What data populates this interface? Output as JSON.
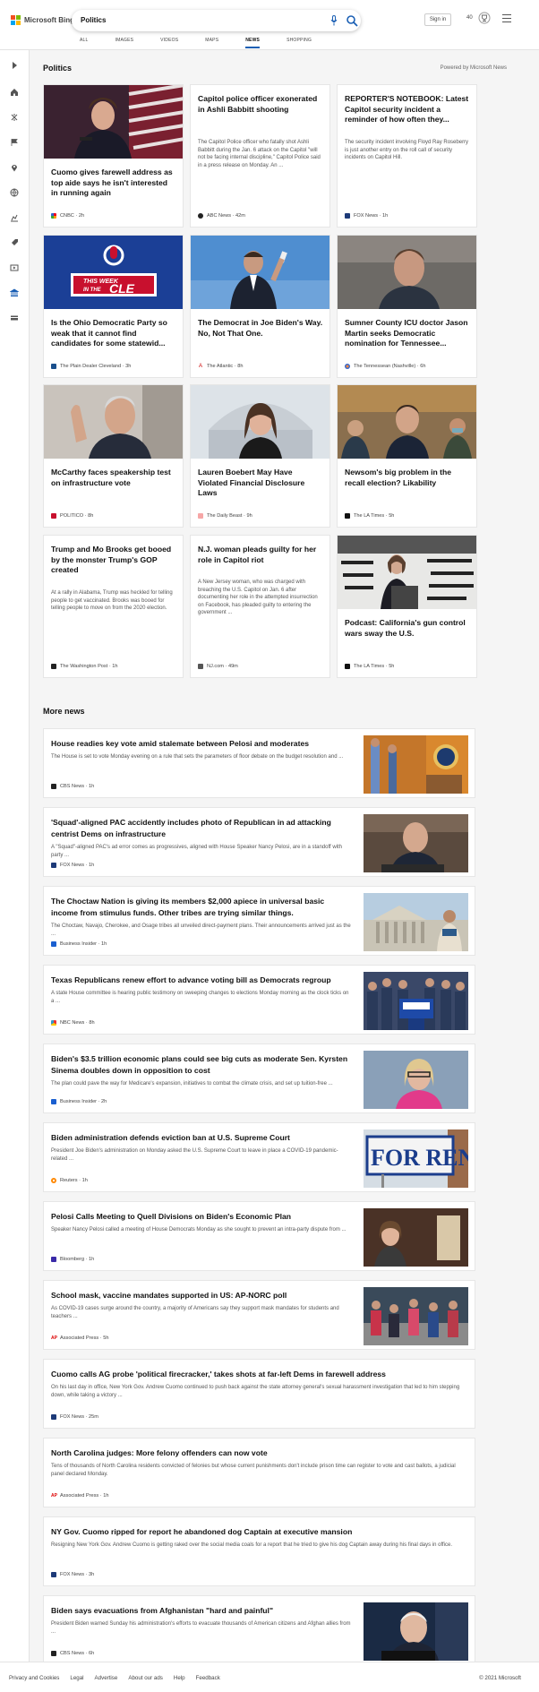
{
  "header": {
    "brand": "Microsoft Bing",
    "query": "Politics",
    "sign_in": "Sign in",
    "rewards": "40",
    "tabs": [
      {
        "label": "ALL"
      },
      {
        "label": "IMAGES"
      },
      {
        "label": "VIDEOS"
      },
      {
        "label": "MAPS"
      },
      {
        "label": "NEWS"
      },
      {
        "label": "SHOPPING"
      }
    ],
    "active_tab": "NEWS"
  },
  "colors": {
    "ms_red": "#f25022",
    "ms_green": "#7fba00",
    "ms_blue": "#00a4ef",
    "ms_yellow": "#ffb900",
    "accent": "#1a5fb4"
  },
  "section": {
    "title": "Politics",
    "powered": "Powered by Microsoft News"
  },
  "cards": [
    {
      "title": "Cuomo gives farewell address as top aide says he isn't interested in running again",
      "desc": "",
      "source": "CNBC",
      "age": "2h",
      "icon": "cnbc-icon",
      "img": "photo-cuomo"
    },
    {
      "title": "Capitol police officer exonerated in Ashli Babbitt shooting",
      "desc": "The Capitol Police officer who fatally shot Ashli Babbitt during the Jan. 6 attack on the Capitol \"will not be facing internal discipline,\" Capitol Police said in a press release on Monday. An ...",
      "source": "ABC News",
      "age": "42m",
      "icon": "abc-news-icon",
      "img": ""
    },
    {
      "title": "REPORTER'S NOTEBOOK: Latest Capitol security incident a reminder of how often they...",
      "desc": "The security incident involving Floyd Ray Roseberry is just another entry on the roll call of security incidents on Capitol Hill.",
      "source": "FOX News",
      "age": "1h",
      "icon": "fox-news-icon",
      "img": ""
    },
    {
      "title": "Is the Ohio Democratic Party so weak that it cannot find candidates for some statewid...",
      "desc": "",
      "source": "The Plain Dealer Cleveland",
      "age": "3h",
      "icon": "plain-dealer-icon",
      "img": "this-week-in-the-cle"
    },
    {
      "title": "The Democrat in Joe Biden's Way. No, Not That One.",
      "desc": "",
      "source": "The Atlantic",
      "age": "8h",
      "icon": "the-atlantic-icon",
      "img": "photo-politician-phone"
    },
    {
      "title": "Sumner County ICU doctor Jason Martin seeks Democratic nomination for Tennessee...",
      "desc": "",
      "source": "The Tennessean (Nashville)",
      "age": "6h",
      "icon": "tennessean-icon",
      "img": "photo-jason-martin"
    },
    {
      "title": "McCarthy faces speakership test on infrastructure vote",
      "desc": "",
      "source": "POLITICO",
      "age": "8h",
      "icon": "politico-icon",
      "img": "photo-mccarthy"
    },
    {
      "title": "Lauren Boebert May Have Violated Financial Disclosure Laws",
      "desc": "",
      "source": "The Daily Beast",
      "age": "9h",
      "icon": "daily-beast-icon",
      "img": "photo-boebert"
    },
    {
      "title": "Newsom's big problem in the recall election? Likability",
      "desc": "",
      "source": "The LA Times",
      "age": "5h",
      "icon": "la-times-icon",
      "img": "photo-newsom"
    },
    {
      "title": "Trump and Mo Brooks get booed by the monster Trump's GOP created",
      "desc": "At a rally in Alabama, Trump was heckled for telling people to get vaccinated. Brooks was booed for telling people to move on from the 2020 election.",
      "source": "The Washington Post",
      "age": "1h",
      "icon": "washington-post-icon",
      "img": ""
    },
    {
      "title": "N.J. woman pleads guilty for her role in Capitol riot",
      "desc": "A New Jersey woman, who was charged with breaching the U.S. Capitol on Jan. 6 after documenting her role in the attempted insurrection on Facebook, has pleaded guilty to entering the government ...",
      "source": "NJ.com",
      "age": "49m",
      "icon": "nj-com-icon",
      "img": ""
    },
    {
      "title": "Podcast: California's gun control wars sway the U.S.",
      "desc": "",
      "source": "The LA Times",
      "age": "5h",
      "icon": "la-times-icon",
      "img": "photo-gun-display"
    }
  ],
  "more_news": {
    "title": "More news",
    "items": [
      {
        "title": "House readies key vote amid stalemate between Pelosi and moderates",
        "desc": "The House is set to vote Monday evening on a rule that sets the parameters of floor debate on the budget resolution and ...",
        "source": "CBS News",
        "age": "1h",
        "icon": "cbs-news-icon",
        "img": "photo-house-podium"
      },
      {
        "title": "'Squad'-aligned PAC accidently includes photo of Republican in ad attacking centrist Dems on infrastructure",
        "desc": "A \"Squad\"-aligned PAC's ad error comes as progressives, aligned with House Speaker Nancy Pelosi, are in a standoff with party ...",
        "source": "FOX News",
        "age": "1h",
        "icon": "fox-news-icon",
        "img": "photo-senator"
      },
      {
        "title": "The Choctaw Nation is giving its members $2,000 apiece in universal basic income from stimulus funds. Other tribes are trying similar things.",
        "desc": "The Choctaw, Navajo, Cherokee, and Osage tribes all unveiled direct-payment plans. Their announcements arrived just as the ...",
        "source": "Business Insider",
        "age": "1h",
        "icon": "business-insider-icon",
        "img": "photo-capitol-building"
      },
      {
        "title": "Texas Republicans renew effort to advance voting bill as Democrats regroup",
        "desc": "A state House committee is hearing public testimony on sweeping changes to elections Monday morning as the clock ticks on a ...",
        "source": "NBC News",
        "age": "8h",
        "icon": "nbc-news-icon",
        "img": "photo-rally"
      },
      {
        "title": "Biden's $3.5 trillion economic plans could see big cuts as moderate Sen. Kyrsten Sinema doubles down in opposition to cost",
        "desc": "The plan could pave the way for Medicare's expansion, initiatives to combat the climate crisis, and set up tuition-free ...",
        "source": "Business Insider",
        "age": "2h",
        "icon": "business-insider-icon",
        "img": "photo-sinema"
      },
      {
        "title": "Biden administration defends eviction ban at U.S. Supreme Court",
        "desc": "President Joe Biden's administration on Monday asked the U.S. Supreme Court to leave in place a COVID-19 pandemic-related ...",
        "source": "Reuters",
        "age": "1h",
        "icon": "reuters-icon",
        "img": "for-rent-sign",
        "img_text": "FOR RENT"
      },
      {
        "title": "Pelosi Calls Meeting to Quell Divisions on Biden's Economic Plan",
        "desc": "Speaker Nancy Pelosi called a meeting of House Democrats Monday as she sought to prevent an intra-party dispute from ...",
        "source": "Bloomberg",
        "age": "1h",
        "icon": "bloomberg-icon",
        "img": "photo-pelosi"
      },
      {
        "title": "School mask, vaccine mandates supported in US: AP-NORC poll",
        "desc": "As COVID-19 cases surge around the country, a majority of Americans say they support mask mandates for students and teachers ...",
        "source": "Associated Press",
        "age": "5h",
        "icon": "associated-press-icon",
        "img": "photo-students"
      },
      {
        "title": "Cuomo calls AG probe 'political firecracker,' takes shots at far-left Dems in farewell address",
        "desc": "On his last day in office, New York Gov. Andrew Cuomo continued to push back against the state attorney general's sexual harassment investigation that led to him stepping down, while taking a victory ...",
        "source": "FOX News",
        "age": "25m",
        "icon": "fox-news-icon",
        "img": ""
      },
      {
        "title": "North Carolina judges: More felony offenders can now vote",
        "desc": "Tens of thousands of North Carolina residents convicted of felonies but whose current punishments don't include prison time can register to vote and cast ballots, a judicial panel declared Monday.",
        "source": "Associated Press",
        "age": "1h",
        "icon": "associated-press-icon",
        "img": ""
      },
      {
        "title": "NY Gov. Cuomo ripped for report he abandoned dog Captain at executive mansion",
        "desc": "Resigning New York Gov. Andrew Cuomo is getting raked over the social media coals for a report that he tried to give his dog Captain away during his final days in office.",
        "source": "FOX News",
        "age": "3h",
        "icon": "fox-news-icon",
        "img": ""
      },
      {
        "title": "Biden says evacuations from Afghanistan \"hard and painful\"",
        "desc": "President Biden warned Sunday his administration's efforts to evacuate thousands of American citizens and Afghan allies from ...",
        "source": "CBS News",
        "age": "6h",
        "icon": "cbs-news-icon",
        "img": "photo-biden"
      }
    ]
  },
  "footer": {
    "links": [
      "Privacy and Cookies",
      "Legal",
      "Advertise",
      "About our ads",
      "Help",
      "Feedback"
    ],
    "copyright": "© 2021 Microsoft"
  }
}
